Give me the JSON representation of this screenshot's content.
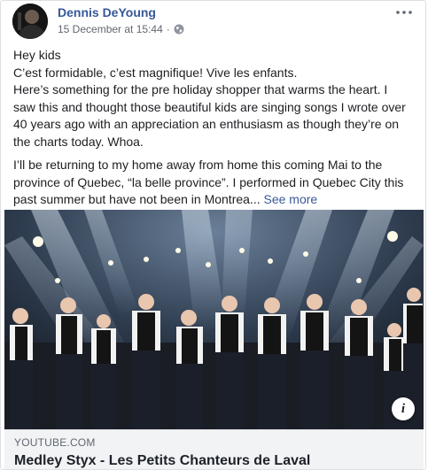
{
  "post": {
    "author": "Dennis DeYoung",
    "timestamp": "15 December at 15:44",
    "separator": "·",
    "privacy_icon": "globe-icon",
    "more_icon": "more-dots-icon",
    "paragraph1": [
      "Hey kids",
      "C’est formidable, c’est magnifique! Vive les enfants.",
      "Here’s something for the pre holiday shopper that warms the heart. I",
      "saw this and thought those beautiful kids are singing songs I wrote over",
      "40 years ago with an appreciation an enthusiasm as though they’re on",
      "the charts today. Whoa."
    ],
    "paragraph2": [
      "I’ll be returning to my home away from home this coming Mai to the",
      "province of Quebec, “la belle province”. I performed in Quebec City this",
      "past summer but have not been in Montrea..."
    ],
    "see_more": "See more"
  },
  "link_preview": {
    "domain": "YOUTUBE.COM",
    "title": "Medley Styx - Les Petits Chanteurs de Laval",
    "info_icon": "info-icon",
    "info_label": "i"
  },
  "colors": {
    "author": "#365899",
    "link": "#385898",
    "meta": "#616770",
    "preview_bg": "#f2f3f5"
  }
}
